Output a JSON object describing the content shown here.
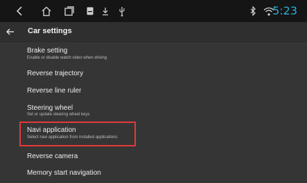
{
  "status_bar": {
    "icons": [
      "back-chevron-icon",
      "home-icon",
      "recents-icon",
      "menu-icon",
      "download-icon",
      "usb-icon",
      "bluetooth-icon",
      "wifi-icon"
    ],
    "clock": "5:23",
    "clock_color": "#28b0d6"
  },
  "header": {
    "title": "Car settings"
  },
  "settings": [
    {
      "label": "Brake setting",
      "sub": "Enable or disable watch video when driving"
    },
    {
      "label": "Reverse trajectory",
      "sub": ""
    },
    {
      "label": "Reverse line ruler",
      "sub": ""
    },
    {
      "label": "Steering wheel",
      "sub": "Set or update steering wheel keys"
    },
    {
      "label": "Navi application",
      "sub": "Select navi application from installed applications",
      "highlighted": true
    },
    {
      "label": "Reverse camera",
      "sub": ""
    },
    {
      "label": "Memory start navigation",
      "sub": ""
    }
  ],
  "highlight_color": "#e53a3a"
}
